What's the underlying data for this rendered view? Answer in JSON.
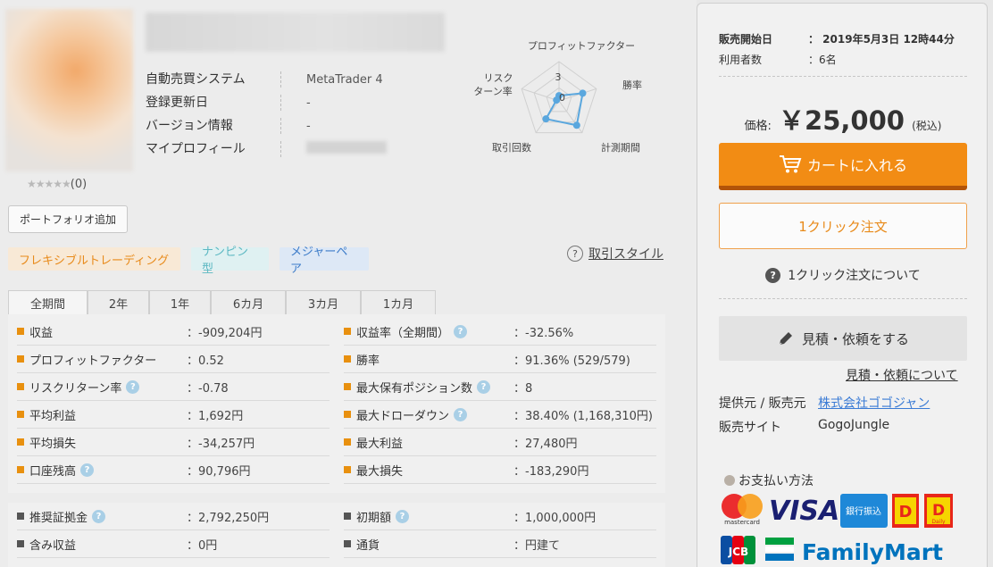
{
  "product": {
    "rating_stars": "★★★★★",
    "rating_count": "(0)",
    "portfolio_button": "ポートフォリオ追加",
    "info": [
      {
        "key": "自動売買システム",
        "value": "MetaTrader 4"
      },
      {
        "key": "登録更新日",
        "value": "-"
      },
      {
        "key": "バージョン情報",
        "value": "-"
      },
      {
        "key": "マイプロフィール",
        "value": ""
      }
    ]
  },
  "chart_data": {
    "type": "radar",
    "axes": [
      "プロフィットファクター",
      "勝率",
      "計測期間",
      "取引回数",
      "リスクリターン率"
    ],
    "scale_labels": [
      "3",
      "0"
    ],
    "values": [
      0.4,
      1.9,
      2.3,
      1.7,
      0.2
    ],
    "color": "#5aa7de"
  },
  "tags": [
    "フレキシブルトレーディング",
    "ナンピン型",
    "メジャーペア"
  ],
  "trade_style_link": "取引スタイル",
  "tabs": [
    "全期間",
    "2年",
    "1年",
    "6カ月",
    "3カ月",
    "1カ月"
  ],
  "stats_left": [
    {
      "label": "収益",
      "value": "：-909,204円",
      "help": false
    },
    {
      "label": "プロフィットファクター",
      "value": "：0.52",
      "help": false
    },
    {
      "label": "リスクリターン率",
      "value": "：-0.78",
      "help": true
    },
    {
      "label": "平均利益",
      "value": "：1,692円",
      "help": false
    },
    {
      "label": "平均損失",
      "value": "：-34,257円",
      "help": false
    },
    {
      "label": "口座残高",
      "value": "：90,796円",
      "help": true
    }
  ],
  "stats_right": [
    {
      "label": "収益率（全期間）",
      "value": "：-32.56%",
      "help": true
    },
    {
      "label": "勝率",
      "value": "：91.36% (529/579)",
      "help": false
    },
    {
      "label": "最大保有ポジション数",
      "value": "：8",
      "help": true
    },
    {
      "label": "最大ドローダウン",
      "value": "：38.40% (1,168,310円)",
      "help": true
    },
    {
      "label": "最大利益",
      "value": "：27,480円",
      "help": false
    },
    {
      "label": "最大損失",
      "value": "：-183,290円",
      "help": false
    }
  ],
  "stats2_left": [
    {
      "label": "推奨証拠金",
      "value": "：2,792,250円",
      "help": true
    },
    {
      "label": "含み収益",
      "value": "：0円",
      "help": false
    }
  ],
  "stats2_right": [
    {
      "label": "初期額",
      "value": "：1,000,000円",
      "help": true
    },
    {
      "label": "通貨",
      "value": "：円建て",
      "help": false
    }
  ],
  "sidebar": {
    "release_label": "販売開始日",
    "release_value": "：  2019年5月3日 12時44分",
    "users_label": "利用者数",
    "users_value": "：6名",
    "price_label": "価格:",
    "price_value": "￥25,000",
    "price_tax": "(税込)",
    "cart_button": "カートに入れる",
    "oneclick_button": "1クリック注文",
    "oneclick_about": "1クリック注文について",
    "quote_button": "見積・依頼をする",
    "quote_about": "見積・依頼について",
    "provider_label": "提供元 / 販売元",
    "provider_value": "株式会社ゴゴジャン",
    "site_label": "販売サイト",
    "site_value": "GogoJungle",
    "payment_title": "お支払い方法",
    "payment": {
      "visa": "VISA",
      "mastercard": "mastercard",
      "bank": "銀行振込",
      "daily": "Daily",
      "jcb": "JCB",
      "familymart": "FamilyMart"
    }
  }
}
